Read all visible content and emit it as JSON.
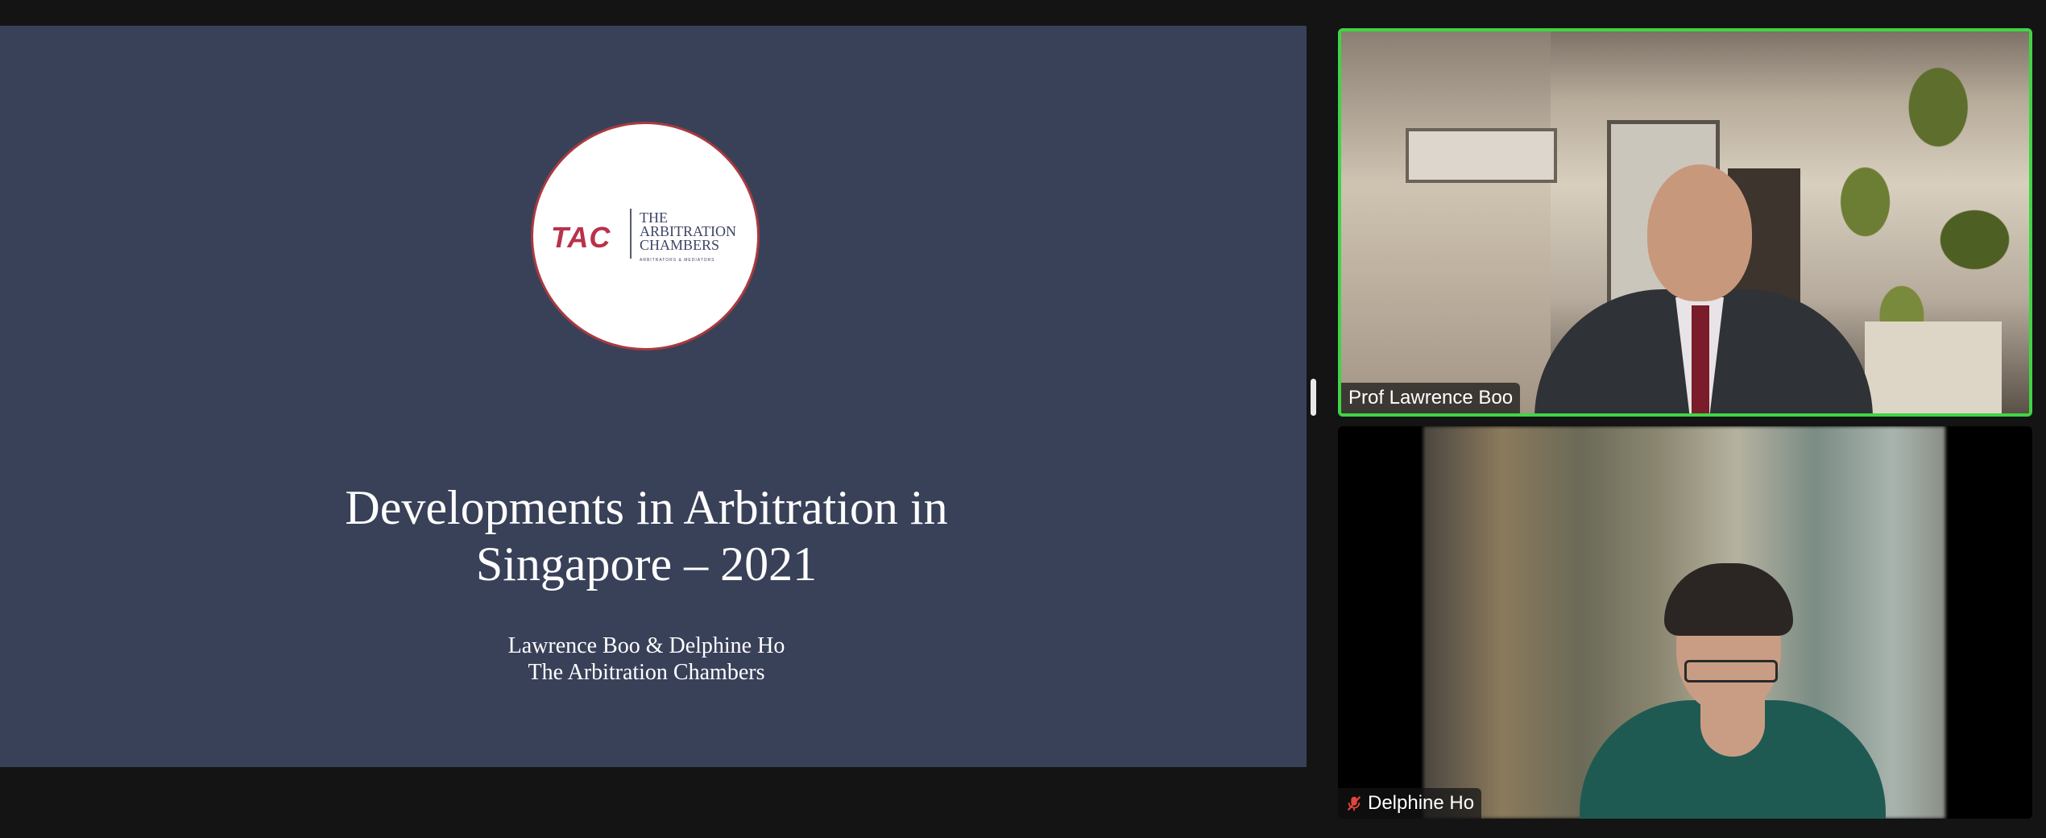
{
  "slide": {
    "logo": {
      "mark": "TAC",
      "name_lines": [
        "THE",
        "ARBITRATION",
        "CHAMBERS"
      ],
      "tagline": "Arbitrators & Mediators"
    },
    "title_lines": [
      "Developments in Arbitration in",
      "Singapore – 2021"
    ],
    "subtitle_lines": [
      "Lawrence Boo & Delphine Ho",
      "The Arbitration Chambers"
    ]
  },
  "participants": [
    {
      "name": "Prof Lawrence Boo",
      "active_speaker": true,
      "muted": false
    },
    {
      "name": "Delphine Ho",
      "active_speaker": false,
      "muted": true
    }
  ],
  "colors": {
    "active_speaker_border": "#3fd545",
    "slide_background": "#394159",
    "muted_icon": "#e0463c"
  },
  "icons": {
    "muted_mic": "mic-muted-icon"
  }
}
